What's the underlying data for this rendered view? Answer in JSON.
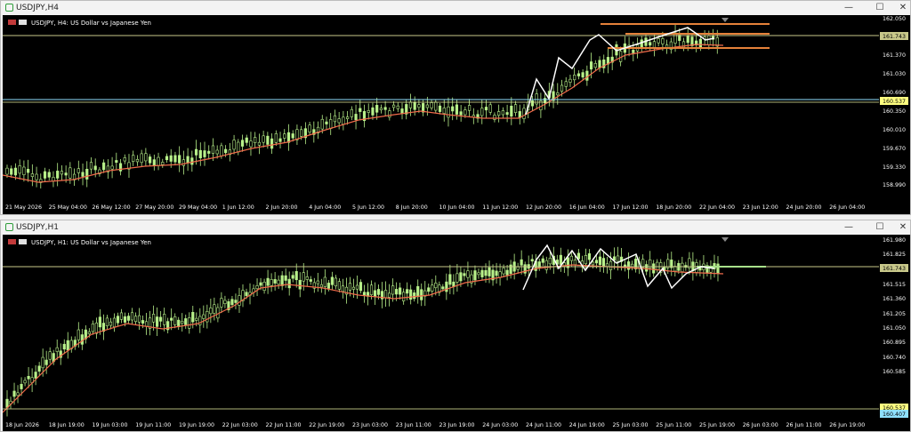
{
  "windows": [
    {
      "id": "h4",
      "title": "USDJPY,H4",
      "header": "USDJPY, H4:  US Dollar vs Japanese Yen",
      "price_labels": [
        "162.050",
        "161.743",
        "161.370",
        "161.030",
        "160.690",
        "160.537",
        "160.350",
        "160.010",
        "159.670",
        "159.330",
        "158.990"
      ],
      "current_price": "161.743",
      "alt_price": "160.537",
      "time_labels": [
        "21 May 2026",
        "25 May 04:00",
        "26 May 12:00",
        "27 May 20:00",
        "29 May 04:00",
        "1 Jun 12:00",
        "2 Jun 20:00",
        "4 Jun 04:00",
        "5 Jun 12:00",
        "8 Jun 20:00",
        "10 Jun 04:00",
        "11 Jun 12:00",
        "12 Jun 20:00",
        "16 Jun 04:00",
        "17 Jun 12:00",
        "18 Jun 20:00",
        "22 Jun 04:00",
        "23 Jun 12:00",
        "24 Jun 20:00",
        "26 Jun 04:00"
      ]
    },
    {
      "id": "h1",
      "title": "USDJPY,H1",
      "header": "USDJPY, H1:  US Dollar vs Japanese Yen",
      "price_labels": [
        "161.980",
        "161.825",
        "161.743",
        "161.515",
        "161.360",
        "161.205",
        "161.050",
        "160.895",
        "160.740",
        "160.585",
        "160.537",
        "160.407"
      ],
      "current_price": "161.743",
      "alt_price": "160.537",
      "low_price": "160.407",
      "time_labels": [
        "18 Jun 2026",
        "18 Jun 19:00",
        "19 Jun 03:00",
        "19 Jun 11:00",
        "19 Jun 19:00",
        "22 Jun 03:00",
        "22 Jun 11:00",
        "22 Jun 19:00",
        "23 Jun 03:00",
        "23 Jun 11:00",
        "23 Jun 19:00",
        "24 Jun 03:00",
        "24 Jun 11:00",
        "24 Jun 19:00",
        "25 Jun 03:00",
        "25 Jun 11:00",
        "25 Jun 19:00",
        "26 Jun 03:00",
        "26 Jun 11:00",
        "26 Jun 19:00"
      ]
    }
  ],
  "colors": {
    "background": "#000000",
    "bull": "#b8f08a",
    "ma": "#f06a4a",
    "current_line": "#c8c88a",
    "support_line": "#8fe0ff",
    "zigzag": "#ffffff",
    "level_lines": "#e6823a",
    "text": "#ffffff"
  }
}
